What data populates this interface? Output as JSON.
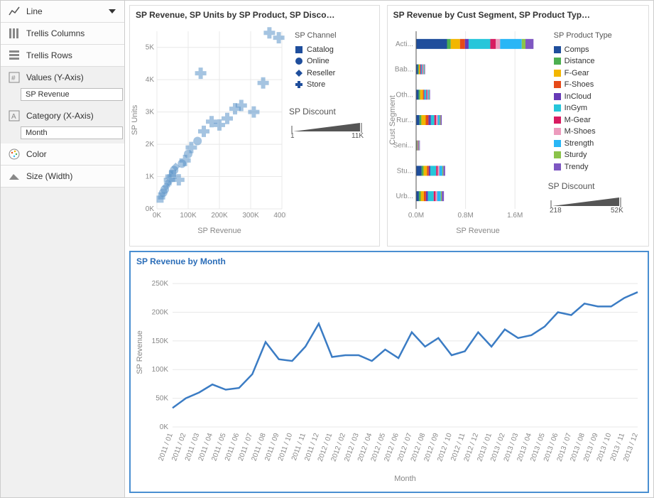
{
  "sidebar": {
    "chart_type": "Line",
    "trellis_cols": "Trellis Columns",
    "trellis_rows": "Trellis Rows",
    "values_label": "Values (Y-Axis)",
    "values_field": "SP Revenue",
    "category_label": "Category (X-Axis)",
    "category_field": "Month",
    "color_label": "Color",
    "size_label": "Size (Width)"
  },
  "scatter": {
    "title": "SP Revenue, SP Units by SP Product, SP Disco…",
    "xlabel": "SP Revenue",
    "ylabel": "SP Units",
    "xticks": [
      "0K",
      "100K",
      "200K",
      "300K",
      "400K"
    ],
    "yticks": [
      "0K",
      "1K",
      "2K",
      "3K",
      "4K",
      "5K"
    ],
    "legend_title": "SP Channel",
    "legend": [
      "Catalog",
      "Online",
      "Reseller",
      "Store"
    ],
    "slider_label": "SP Discount",
    "slider_min": "1",
    "slider_max": "11K"
  },
  "stacked": {
    "title": "SP Revenue by Cust Segment, SP Product Typ…",
    "xlabel": "SP Revenue",
    "ylabel": "Cust Segment",
    "xticks": [
      "0.0M",
      "0.8M",
      "1.6M"
    ],
    "segments": [
      "Acti...",
      "Bab...",
      "Oth...",
      "Rur...",
      "Seni...",
      "Stu...",
      "Urb..."
    ],
    "legend_title": "SP Product Type",
    "legend": [
      "Comps",
      "Distance",
      "F-Gear",
      "F-Shoes",
      "InCloud",
      "InGym",
      "M-Gear",
      "M-Shoes",
      "Strength",
      "Sturdy",
      "Trendy"
    ],
    "legend_colors": [
      "#1f4e9c",
      "#4caf50",
      "#f2b600",
      "#e64a19",
      "#673ab7",
      "#26c6da",
      "#d81b60",
      "#ec9bbd",
      "#29b6f6",
      "#8bc34a",
      "#7e57c2"
    ],
    "slider_label": "SP Discount",
    "slider_min": "218",
    "slider_max": "52K"
  },
  "line": {
    "title": "SP Revenue by Month",
    "xlabel": "Month",
    "ylabel": "SP Revenue",
    "yticks": [
      "0K",
      "50K",
      "100K",
      "150K",
      "200K",
      "250K"
    ]
  },
  "chart_data": [
    {
      "type": "scatter",
      "title": "SP Revenue, SP Units by SP Product, SP Discount",
      "xlabel": "SP Revenue",
      "ylabel": "SP Units",
      "xlim": [
        0,
        400000
      ],
      "ylim": [
        0,
        5500
      ],
      "shape_by": "SP Channel",
      "shape_levels": {
        "Catalog": "square",
        "Online": "circle",
        "Reseller": "diamond",
        "Store": "plus"
      },
      "note": "approximate positions read from chart",
      "points": [
        {
          "x": 10000,
          "y": 300,
          "ch": "Catalog"
        },
        {
          "x": 15000,
          "y": 400,
          "ch": "Catalog"
        },
        {
          "x": 20000,
          "y": 500,
          "ch": "Online"
        },
        {
          "x": 25000,
          "y": 600,
          "ch": "Online"
        },
        {
          "x": 30000,
          "y": 700,
          "ch": "Reseller"
        },
        {
          "x": 35000,
          "y": 800,
          "ch": "Reseller"
        },
        {
          "x": 40000,
          "y": 900,
          "ch": "Store"
        },
        {
          "x": 45000,
          "y": 1000,
          "ch": "Store"
        },
        {
          "x": 50000,
          "y": 1100,
          "ch": "Catalog"
        },
        {
          "x": 55000,
          "y": 1200,
          "ch": "Online"
        },
        {
          "x": 60000,
          "y": 1300,
          "ch": "Reseller"
        },
        {
          "x": 70000,
          "y": 900,
          "ch": "Store"
        },
        {
          "x": 80000,
          "y": 1400,
          "ch": "Online"
        },
        {
          "x": 90000,
          "y": 1500,
          "ch": "Store"
        },
        {
          "x": 100000,
          "y": 1700,
          "ch": "Online"
        },
        {
          "x": 110000,
          "y": 1900,
          "ch": "Store"
        },
        {
          "x": 130000,
          "y": 2100,
          "ch": "Online"
        },
        {
          "x": 140000,
          "y": 4200,
          "ch": "Store"
        },
        {
          "x": 150000,
          "y": 2400,
          "ch": "Store"
        },
        {
          "x": 175000,
          "y": 2700,
          "ch": "Store"
        },
        {
          "x": 200000,
          "y": 2600,
          "ch": "Store"
        },
        {
          "x": 225000,
          "y": 2800,
          "ch": "Store"
        },
        {
          "x": 250000,
          "y": 3100,
          "ch": "Store"
        },
        {
          "x": 270000,
          "y": 3200,
          "ch": "Store"
        },
        {
          "x": 310000,
          "y": 3000,
          "ch": "Store"
        },
        {
          "x": 340000,
          "y": 3900,
          "ch": "Store"
        },
        {
          "x": 360000,
          "y": 5450,
          "ch": "Store"
        },
        {
          "x": 390000,
          "y": 5300,
          "ch": "Store"
        }
      ]
    },
    {
      "type": "bar",
      "stacked": true,
      "orientation": "horizontal",
      "title": "SP Revenue by Cust Segment, SP Product Type",
      "xlabel": "SP Revenue",
      "ylabel": "Cust Segment",
      "categories": [
        "Active",
        "Babies",
        "Other",
        "Rural",
        "Senior",
        "Student",
        "Urban"
      ],
      "series": [
        {
          "name": "Comps",
          "color": "#1f4e9c",
          "values": [
            500000,
            30000,
            40000,
            55000,
            10000,
            90000,
            45000
          ]
        },
        {
          "name": "Distance",
          "color": "#4caf50",
          "values": [
            60000,
            15000,
            25000,
            30000,
            5000,
            30000,
            30000
          ]
        },
        {
          "name": "F-Gear",
          "color": "#f2b600",
          "values": [
            150000,
            15000,
            45000,
            70000,
            5000,
            55000,
            50000
          ]
        },
        {
          "name": "F-Shoes",
          "color": "#e64a19",
          "values": [
            80000,
            10000,
            15000,
            45000,
            5000,
            30000,
            35000
          ]
        },
        {
          "name": "InCloud",
          "color": "#673ab7",
          "values": [
            60000,
            10000,
            10000,
            40000,
            5000,
            25000,
            30000
          ]
        },
        {
          "name": "InGym",
          "color": "#26c6da",
          "values": [
            350000,
            15000,
            30000,
            55000,
            5000,
            95000,
            95000
          ]
        },
        {
          "name": "M-Gear",
          "color": "#d81b60",
          "values": [
            90000,
            10000,
            15000,
            30000,
            5000,
            25000,
            30000
          ]
        },
        {
          "name": "M-Shoes",
          "color": "#ec9bbd",
          "values": [
            70000,
            10000,
            10000,
            25000,
            5000,
            25000,
            25000
          ]
        },
        {
          "name": "Strength",
          "color": "#29b6f6",
          "values": [
            350000,
            10000,
            15000,
            30000,
            5000,
            50000,
            60000
          ]
        },
        {
          "name": "Sturdy",
          "color": "#8bc34a",
          "values": [
            60000,
            10000,
            10000,
            15000,
            5000,
            15000,
            15000
          ]
        },
        {
          "name": "Trendy",
          "color": "#7e57c2",
          "values": [
            130000,
            10000,
            10000,
            20000,
            5000,
            30000,
            35000
          ]
        }
      ],
      "xlim": [
        0,
        2000000
      ]
    },
    {
      "type": "line",
      "title": "SP Revenue by Month",
      "xlabel": "Month",
      "ylabel": "SP Revenue",
      "ylim": [
        0,
        260000
      ],
      "x": [
        "2011 / 01",
        "2011 / 02",
        "2011 / 03",
        "2011 / 04",
        "2011 / 05",
        "2011 / 06",
        "2011 / 07",
        "2011 / 08",
        "2011 / 09",
        "2011 / 10",
        "2011 / 11",
        "2011 / 12",
        "2012 / 01",
        "2012 / 02",
        "2012 / 03",
        "2012 / 04",
        "2012 / 05",
        "2012 / 06",
        "2012 / 07",
        "2012 / 08",
        "2012 / 09",
        "2012 / 10",
        "2012 / 11",
        "2012 / 12",
        "2013 / 01",
        "2013 / 02",
        "2013 / 03",
        "2013 / 04",
        "2013 / 05",
        "2013 / 06",
        "2013 / 07",
        "2013 / 08",
        "2013 / 09",
        "2013 / 10",
        "2013 / 11",
        "2013 / 12"
      ],
      "y": [
        33000,
        50000,
        60000,
        74000,
        65000,
        68000,
        92000,
        148000,
        118000,
        115000,
        140000,
        180000,
        122000,
        125000,
        125000,
        115000,
        135000,
        120000,
        165000,
        140000,
        155000,
        125000,
        132000,
        165000,
        140000,
        170000,
        155000,
        160000,
        175000,
        200000,
        195000,
        215000,
        210000,
        210000,
        225000,
        235000
      ]
    }
  ]
}
